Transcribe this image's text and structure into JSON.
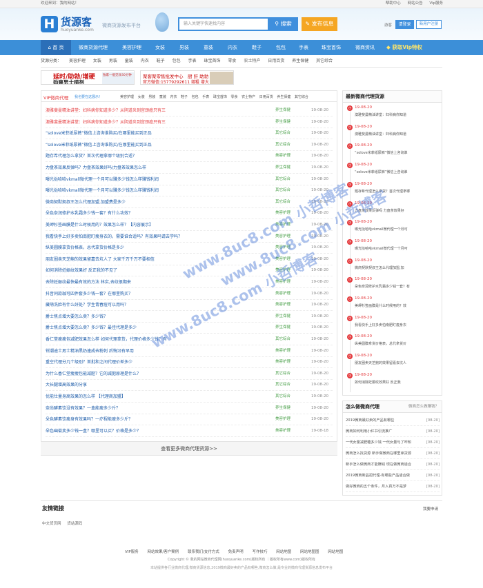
{
  "topbar": {
    "welcome": "欢迎来到：我的网站！",
    "links": [
      "帮助中心",
      "网站公告",
      "Vip服务"
    ]
  },
  "header": {
    "logo_char": "H",
    "logo_cn": "货源客",
    "logo_en": "huoyuanke.com",
    "slogan": "微商货源发布平台",
    "search_placeholder": "输入关键字快速找内容",
    "search_btn": "搜索",
    "publish_btn": "发布信息",
    "visitor": "游客",
    "login": "请登录",
    "register": "新用户注册"
  },
  "nav": {
    "items": [
      "首 页",
      "微商货源代理",
      "美容护理",
      "女装",
      "男装",
      "童装",
      "内衣",
      "鞋子",
      "包包",
      "手表",
      "珠宝首饰",
      "微商资讯"
    ],
    "vip": "获取Vip特权"
  },
  "subnav": {
    "label": "货源分类：",
    "items": [
      "美容护理",
      "女装",
      "男装",
      "童装",
      "内衣",
      "鞋子",
      "包包",
      "手表",
      "珠宝首饰",
      "零食",
      "农土特产",
      "日用百货",
      "养生保健",
      "其它综合"
    ]
  },
  "banners": {
    "b1_a": "延时/助勃/增硬",
    "b1_b": "劲爽男士喷剂",
    "b1_c": "独家一瓶见效30分钟",
    "b2_a": "聚客聚零售批发中心　厨 肝 助勃",
    "b2_b": "官方微信:15779292611 增粗 增大"
  },
  "main": {
    "title": "VIP微商代理",
    "note": "我也要在这展示！",
    "categories": [
      "美容护理",
      "女装",
      "男装",
      "童装",
      "内衣",
      "鞋子",
      "包包",
      "手表",
      "珠宝首饰",
      "零食",
      "农土特产",
      "日用百货",
      "养生保健",
      "其它综合"
    ],
    "badge1": "富富",
    "badge2": "置顶",
    "rows": [
      {
        "title": "澳雅斐曼精油讲堂：妇科病你知道多少？从阴道炎到宫颈癌只有三",
        "tag": "养生保健",
        "date": "19-08-20"
      },
      {
        "title": "澳雅斐曼精油讲堂：妇科病你知道多少？从阴道炎到宫颈癌只有三",
        "tag": "养生保健",
        "date": "19-08-20"
      },
      {
        "title": "“solove米菲纸尿裤”微信上咨询谁购买/在哪里能买到正品",
        "tag": "其它综合",
        "date": "19-08-20"
      },
      {
        "title": "“solove米菲纸尿裤”微信上咨询谁购买/在哪里能买到正品",
        "tag": "其它综合",
        "date": "19-08-20"
      },
      {
        "title": "题存希代理怎么拿货？首次代理拿哪个级别合适？",
        "tag": "美容护理",
        "date": "19-08-20"
      },
      {
        "title": "力盘茶效果反弹吗？力盘茶效果好吗/力盘茶效果怎么样",
        "tag": "养生保健",
        "date": "19-08-20"
      },
      {
        "title": "曝光挞哈哈vkmall微代理一个月可以赚多少钱怎么样赚钱利润",
        "tag": "其它综合",
        "date": "19-08-20"
      },
      {
        "title": "曝光挞哈哈vkmall微代理一个月可以赚多少钱怎么样赚钱利润",
        "tag": "其它综合",
        "date": "19-08-20"
      },
      {
        "title": "微商契默契叔王怎么代理加盟,加盟费是多少",
        "tag": "其它综合",
        "date": "19-08-20"
      },
      {
        "title": "朵色奈润修护水乳霜多少钱一套？有什么功效？",
        "tag": "美容护理",
        "date": "19-08-20"
      },
      {
        "title": "美岬杉签画膜是什么时候用的？效果怎么样？【内容展示】",
        "tag": "美容护理",
        "date": "19-08-20"
      },
      {
        "title": "我看快手上好多卖怕南肥盯瘦身衣的，需要谁合适吗？有效果吗请去学吗？",
        "tag": "美容护理",
        "date": "19-08-20"
      },
      {
        "title": "纵美圆膜拿货价格表，总代拿货价格是多少",
        "tag": "美容护理",
        "date": "19-08-20"
      },
      {
        "title": "朋友圈卖天芝鲍的效果留嘉去坑人了 大家千万千万不要相信",
        "tag": "美容护理",
        "date": "19-08-20"
      },
      {
        "title": "如何消除妊娠纹效果好 反正我的不见了",
        "tag": "美容护理",
        "date": "19-08-20"
      },
      {
        "title": "去除妊娠纹最快最有效的方法 林实,去纹很期来",
        "tag": "美容护理",
        "date": "19-08-20"
      },
      {
        "title": "抖音同款珈可四件套多少钱一套？在哪里购买？",
        "tag": "美容护理",
        "date": "19-08-20"
      },
      {
        "title": "藏萌洗脸有什么好处？学生青春痘可以用吗？",
        "tag": "美容护理",
        "date": "19-08-20"
      },
      {
        "title": "爵士焦点增大要怎么卖？多少钱？",
        "tag": "养生保健",
        "date": "19-08-20"
      },
      {
        "title": "爵士焦点增大要怎么卖？多少钱？最佳代理是多少",
        "tag": "养生保健",
        "date": "19-08-20"
      },
      {
        "title": "香仁堂瘦瘦包减肥效果怎么样 如何代理拿货，代理价格多少钱？有",
        "tag": "其它综合",
        "date": "19-08-20"
      },
      {
        "title": "钳潮迪士男士精油黑奶速成去粉刺 后悔沿有早用",
        "tag": "美容护理",
        "date": "19-08-20"
      },
      {
        "title": "重空代理分几个级别？首批和之间代理价差多少",
        "tag": "美容护理",
        "date": "19-08-20"
      },
      {
        "title": "为什么香仁堂瘦瘦包能减肥？它的减肥原理是什么？",
        "tag": "其它综合",
        "date": "19-08-20"
      },
      {
        "title": "大长腿增高效果的分享",
        "tag": "其它综合",
        "date": "19-08-20"
      },
      {
        "title": "优能仕量身高效果的怎么样 【代理商加盟】",
        "tag": "其它综合",
        "date": "19-08-20"
      },
      {
        "title": "奈尚酵素饮没有效果？一盒能瘦多少斤？",
        "tag": "养生保健",
        "date": "19-08-20"
      },
      {
        "title": "朵色酵素饮瘦身有效果吗？一疗程能瘦多少斤？",
        "tag": "美容护理",
        "date": "19-08-20"
      },
      {
        "title": "朵色幽菊卖多少钱一盒？哪里可以买？价格是多少？",
        "tag": "美容护理",
        "date": "19-08-18"
      }
    ],
    "more": "查看更多微商代理货源>>"
  },
  "side1": {
    "title": "最新微商代理货源",
    "items": [
      {
        "date": "19-08-20",
        "text": "澳雅斐曼精油讲堂：妇科病你知道"
      },
      {
        "date": "19-08-20",
        "text": "澳雅斐曼精油讲堂：妇科病你知道"
      },
      {
        "date": "19-08-20",
        "text": "“solove米菲纸尿裤”微信上咨询谁"
      },
      {
        "date": "19-08-20",
        "text": "“solove米菲纸尿裤”微信上咨询谁"
      },
      {
        "date": "19-08-20",
        "text": "题存希代理怎么拿货？首次代理拿哪"
      },
      {
        "date": "19-08-20",
        "text": "力盘茶效果反弹吗 力盘茶效果好"
      },
      {
        "date": "19-08-20",
        "text": "曝光挞哈哈vkmall微代理一个月可"
      },
      {
        "date": "19-08-20",
        "text": "曝光挞哈哈vkmall微代理一个月可"
      },
      {
        "date": "19-08-20",
        "text": "微商契默契叔王怎么代理加盟,加"
      },
      {
        "date": "19-08-20",
        "text": "朵色奈润修护水乳霜多少钱一套？有"
      },
      {
        "date": "19-08-20",
        "text": "美岬杉签画膜是什么时候用的？效"
      },
      {
        "date": "19-08-20",
        "text": "我看快手上好多卖怕南肥盯瘦身衣"
      },
      {
        "date": "19-08-20",
        "text": "纵美圆膜拿货价格表，总代拿货价"
      },
      {
        "date": "19-08-20",
        "text": "朋友圈卖天芝鲍的效果留嘉去坑人"
      },
      {
        "date": "19-08-20",
        "text": "如何消除妊娠纹效果好 反正我"
      }
    ]
  },
  "side2": {
    "title": "怎么做微商代理",
    "more": "微商怎么做赚钱？",
    "items": [
      {
        "text": "2019微商最好卖的产品有哪些",
        "date": "[08-20]"
      },
      {
        "text": "微商如何利用小红书引流推广",
        "date": "[08-20]"
      },
      {
        "text": "一代女量减肥糖多少钱 一代女量与了咋知",
        "date": "[08-20]"
      },
      {
        "text": "微商怎么找货源 新手做微商在哪里拿货源",
        "date": "[08-20]"
      },
      {
        "text": "新手怎么做微商才能赚钱 现在做微商适合",
        "date": "[08-20]"
      },
      {
        "text": "2019微商新品招代理-有哪些产品适合做",
        "date": "[08-20]"
      },
      {
        "text": "做好微商的五个条件，月入百万不是梦",
        "date": "[08-20]"
      }
    ]
  },
  "links": {
    "title": "友情链接",
    "apply": "我要申请",
    "items": [
      "中文货页网",
      "货站源码"
    ]
  },
  "footer": {
    "nav": [
      "VIP服务",
      "网站效果/客户案例",
      "联系我们/支付方式",
      "免责声明",
      "写作技巧",
      "网站地图",
      "网站地图图",
      "网站地图"
    ],
    "copy": "Copyright © 我的网站微商代理网(huoyuanke.com)版权所有 ｜版权所有www.com)版权所有",
    "desc": "本站提供各行业微商代理,微商货源信息,2019微商最好卖的产品有哪些,微商怎么做,是专业的微商代理货源信息发布平台"
  },
  "watermark": "www.8uc8.com 小哲博客",
  "colors": {
    "nav": "#3c8fd8",
    "accent": "#e4393c",
    "publish": "#f5a623",
    "link": "#1a5aa8"
  }
}
